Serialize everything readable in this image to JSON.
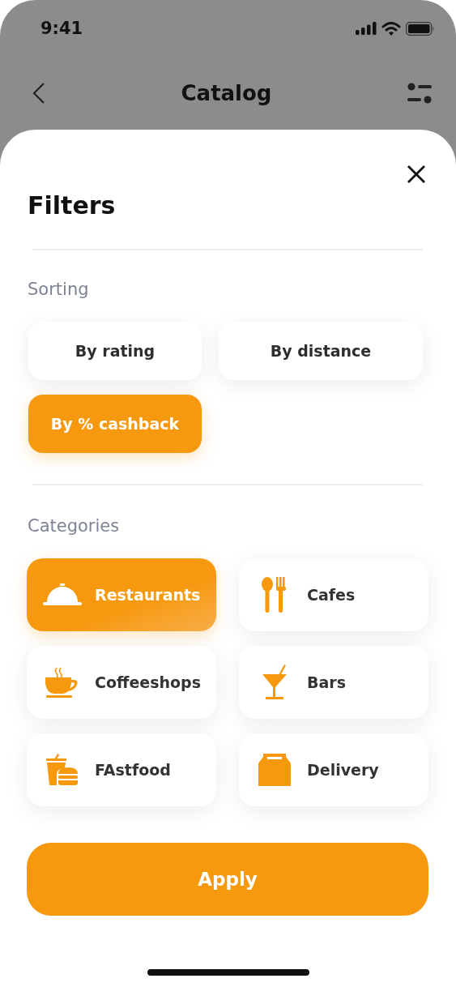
{
  "status_bar": {
    "time": "9:41"
  },
  "nav": {
    "title": "Catalog"
  },
  "sheet": {
    "title": "Filters",
    "sorting": {
      "label": "Sorting",
      "options": [
        {
          "label": "By rating",
          "selected": false
        },
        {
          "label": "By distance",
          "selected": false
        },
        {
          "label": "By % cashback",
          "selected": true
        }
      ]
    },
    "categories": {
      "label": "Categories",
      "items": [
        {
          "kind": "cloche",
          "label": "Restaurants",
          "selected": true
        },
        {
          "kind": "cutlery",
          "label": "Cafes",
          "selected": false
        },
        {
          "kind": "cup",
          "label": "Coffeeshops",
          "selected": false
        },
        {
          "kind": "cocktail",
          "label": "Bars",
          "selected": false
        },
        {
          "kind": "burger",
          "label": "FAstfood",
          "selected": false
        },
        {
          "kind": "bag",
          "label": "Delivery",
          "selected": false
        }
      ]
    },
    "apply_button": "Apply"
  }
}
